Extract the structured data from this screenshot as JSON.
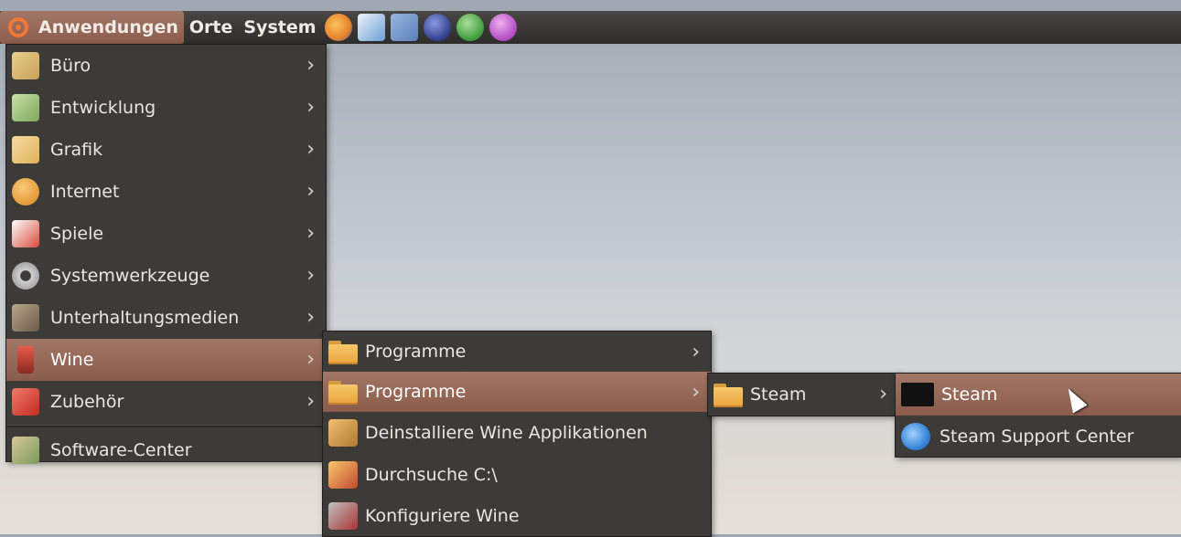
{
  "panel": {
    "items": [
      {
        "label": "Anwendungen"
      },
      {
        "label": "Orte"
      },
      {
        "label": "System"
      }
    ],
    "launchers": [
      {
        "icon": "firefox-icon",
        "color": "#e8822c"
      },
      {
        "icon": "text-editor-icon",
        "color": "#6aa0d4"
      },
      {
        "icon": "equation-icon",
        "color": "#5a7fb8"
      },
      {
        "icon": "eclipse-icon",
        "color": "#2f3e8c"
      },
      {
        "icon": "media-player-icon",
        "color": "#5ab552"
      },
      {
        "icon": "pidgin-icon",
        "color": "#c86ad0"
      }
    ]
  },
  "apps_menu": [
    {
      "label": "Büro",
      "icon": "office-icon",
      "color": "#c9a15a"
    },
    {
      "label": "Entwicklung",
      "icon": "development-icon",
      "color": "#7ea85a"
    },
    {
      "label": "Grafik",
      "icon": "graphics-icon",
      "color": "#e0b05a"
    },
    {
      "label": "Internet",
      "icon": "internet-icon",
      "color": "#e59a3a"
    },
    {
      "label": "Spiele",
      "icon": "games-icon",
      "color": "#d84a3a"
    },
    {
      "label": "Systemwerkzeuge",
      "icon": "system-tools-icon",
      "color": "#a9a9a9"
    },
    {
      "label": "Unterhaltungsmedien",
      "icon": "multimedia-icon",
      "color": "#8a7a6a"
    },
    {
      "label": "Wine",
      "icon": "wine-icon",
      "color": "#b23a2e"
    },
    {
      "label": "Zubehör",
      "icon": "accessories-icon",
      "color": "#d43a2e"
    },
    {
      "label": "Software-Center",
      "icon": "software-center-icon",
      "color": "#7a9a5a"
    }
  ],
  "wine_menu": [
    {
      "label": "Programme"
    },
    {
      "label": "Programme"
    },
    {
      "label": "Deinstalliere Wine Applikationen",
      "icon": "uninstall-icon",
      "color": "#d8a040"
    },
    {
      "label": "Durchsuche C:\\",
      "icon": "browse-c-icon",
      "color": "#e0a040"
    },
    {
      "label": "Konfiguriere Wine",
      "icon": "configure-wine-icon",
      "color": "#a33"
    }
  ],
  "programme_menu": [
    {
      "label": "Steam"
    }
  ],
  "steam_menu": [
    {
      "label": "Steam",
      "icon": "steam-icon",
      "color": "#111111"
    },
    {
      "label": "Steam Support Center",
      "icon": "internet-explorer-icon",
      "color": "#2a7ad4"
    }
  ],
  "arrow_glyph": "›"
}
